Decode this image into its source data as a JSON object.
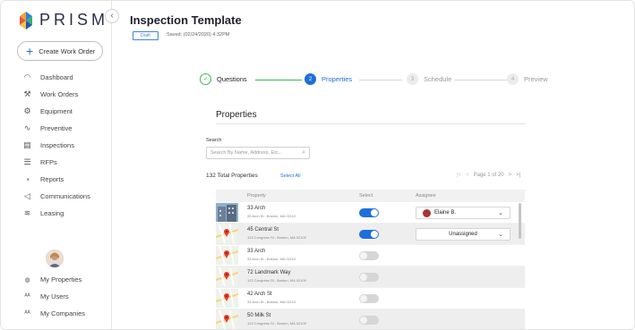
{
  "app": {
    "logo_text": "PRISM",
    "collapse_glyph": "‹"
  },
  "sidebar": {
    "create_button": "Create Work Order",
    "items": [
      {
        "label": "Dashboard",
        "icon": "gauge-icon",
        "glyph": "◠"
      },
      {
        "label": "Work Orders",
        "icon": "wrench-icon",
        "glyph": "⚒"
      },
      {
        "label": "Equipment",
        "icon": "gears-icon",
        "glyph": "⚙"
      },
      {
        "label": "Preventive",
        "icon": "pulse-icon",
        "glyph": "∿"
      },
      {
        "label": "Inspections",
        "icon": "clipboard-icon",
        "glyph": "▤"
      },
      {
        "label": "RFPs",
        "icon": "list-icon",
        "glyph": "☰"
      },
      {
        "label": "Reports",
        "icon": "chart-pie-icon",
        "glyph": "◔"
      },
      {
        "label": "Communications",
        "icon": "megaphone-icon",
        "glyph": "◁"
      },
      {
        "label": "Leasing",
        "icon": "layers-icon",
        "glyph": "≋"
      }
    ],
    "bottom_items": [
      {
        "label": "My Properties",
        "icon": "globe-icon",
        "glyph": "◍"
      },
      {
        "label": "My Users",
        "icon": "users-icon",
        "glyph": "ᴬᴬ"
      },
      {
        "label": "My Companies",
        "icon": "companies-icon",
        "glyph": "ᴬᴬ"
      }
    ]
  },
  "header": {
    "title": "Inspection Template",
    "status_badge": "Draft",
    "saved_text": "Saved: (02/24/2020) 4:32PM"
  },
  "stepper": {
    "steps": [
      {
        "label": "Questions",
        "number": "✓",
        "state": "done"
      },
      {
        "label": "Properties",
        "number": "2",
        "state": "active"
      },
      {
        "label": "Schedule",
        "number": "3",
        "state": "pending"
      },
      {
        "label": "Preview",
        "number": "4",
        "state": "pending"
      }
    ]
  },
  "properties": {
    "section_title": "Properties",
    "search_label": "Search",
    "search_placeholder": "Search By Name, Address, Etc...",
    "total_text": "132 Total Properties",
    "select_all": "Select All",
    "pager": {
      "first": "|<",
      "prev": "<",
      "page_text": "Page 1 of 20",
      "next": ">",
      "last": ">|"
    },
    "columns": [
      "Property",
      "Select",
      "Assignee"
    ],
    "rows": [
      {
        "name": "33 Arch",
        "address": "33 Arch St., Boston, MA 02110",
        "selected": true,
        "assignee": "Elaine B.",
        "thumb": "building"
      },
      {
        "name": "45 Central St",
        "address": "123 Congress St., Boston, MA 02109",
        "selected": true,
        "assignee": "Unassigned",
        "thumb": "map"
      },
      {
        "name": "33 Arch",
        "address": "33 Arch St., Boston, MA 02110",
        "selected": false,
        "assignee": "",
        "thumb": "map"
      },
      {
        "name": "72 Landmark Way",
        "address": "123 Congress St., Boston, MA 02109",
        "selected": false,
        "assignee": "",
        "thumb": "map"
      },
      {
        "name": "42 Arch St",
        "address": "33 Arch St., Boston, MA 02110",
        "selected": false,
        "assignee": "",
        "thumb": "map"
      },
      {
        "name": "50 Milk St",
        "address": "123 Congress St., Boston, MA 02109",
        "selected": false,
        "assignee": "",
        "thumb": "map"
      }
    ]
  },
  "colors": {
    "accent": "#1e6fd9",
    "success": "#3fb950",
    "logo_orange": "#f2a23a",
    "logo_blue": "#2f7fe0",
    "logo_green": "#37b26c"
  }
}
